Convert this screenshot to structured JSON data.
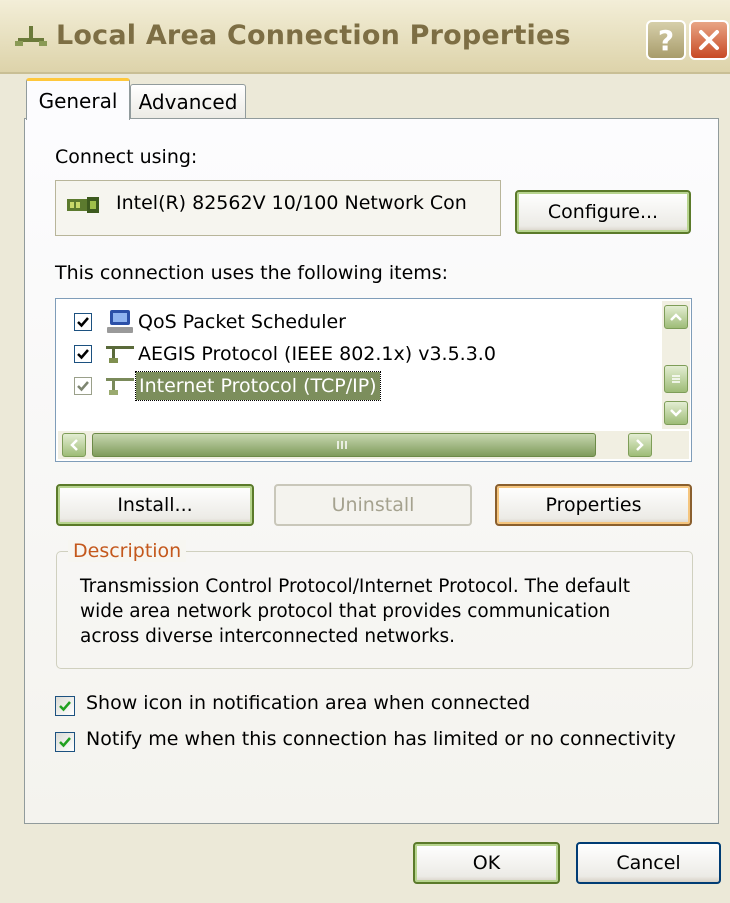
{
  "window": {
    "title": "Local Area Connection Properties",
    "help_label": "?",
    "close_label": "X"
  },
  "tabs": [
    {
      "label": "General",
      "selected": true
    },
    {
      "label": "Advanced",
      "selected": false
    }
  ],
  "connect_using": {
    "label": "Connect using:",
    "adapter": "Intel(R) 82562V 10/100 Network Con",
    "adapter_icon": "network-card-icon",
    "configure_label": "Configure..."
  },
  "items_section": {
    "label": "This connection uses the following items:",
    "items": [
      {
        "label": "QoS Packet Scheduler",
        "checked": true,
        "icon": "computer-icon",
        "selected": false
      },
      {
        "label": "AEGIS Protocol (IEEE 802.1x) v3.5.3.0",
        "checked": true,
        "icon": "network-protocol-icon",
        "selected": false
      },
      {
        "label": "Internet Protocol (TCP/IP)",
        "checked": true,
        "icon": "network-protocol-icon",
        "selected": true
      }
    ]
  },
  "buttons": {
    "install_label": "Install...",
    "uninstall_label": "Uninstall",
    "properties_label": "Properties",
    "ok_label": "OK",
    "cancel_label": "Cancel"
  },
  "description": {
    "legend": "Description",
    "text": "Transmission Control Protocol/Internet Protocol. The default wide area network protocol that provides communication across diverse interconnected networks."
  },
  "options": [
    {
      "label": "Show icon in notification area when connected",
      "checked": true
    },
    {
      "label": "Notify me when this connection has limited or no connectivity",
      "checked": true
    }
  ],
  "colors": {
    "theme_olive": "#7d6e44",
    "selection": "#7c8e5c",
    "legend": "#c4581c",
    "close_red": "#c84a25"
  }
}
